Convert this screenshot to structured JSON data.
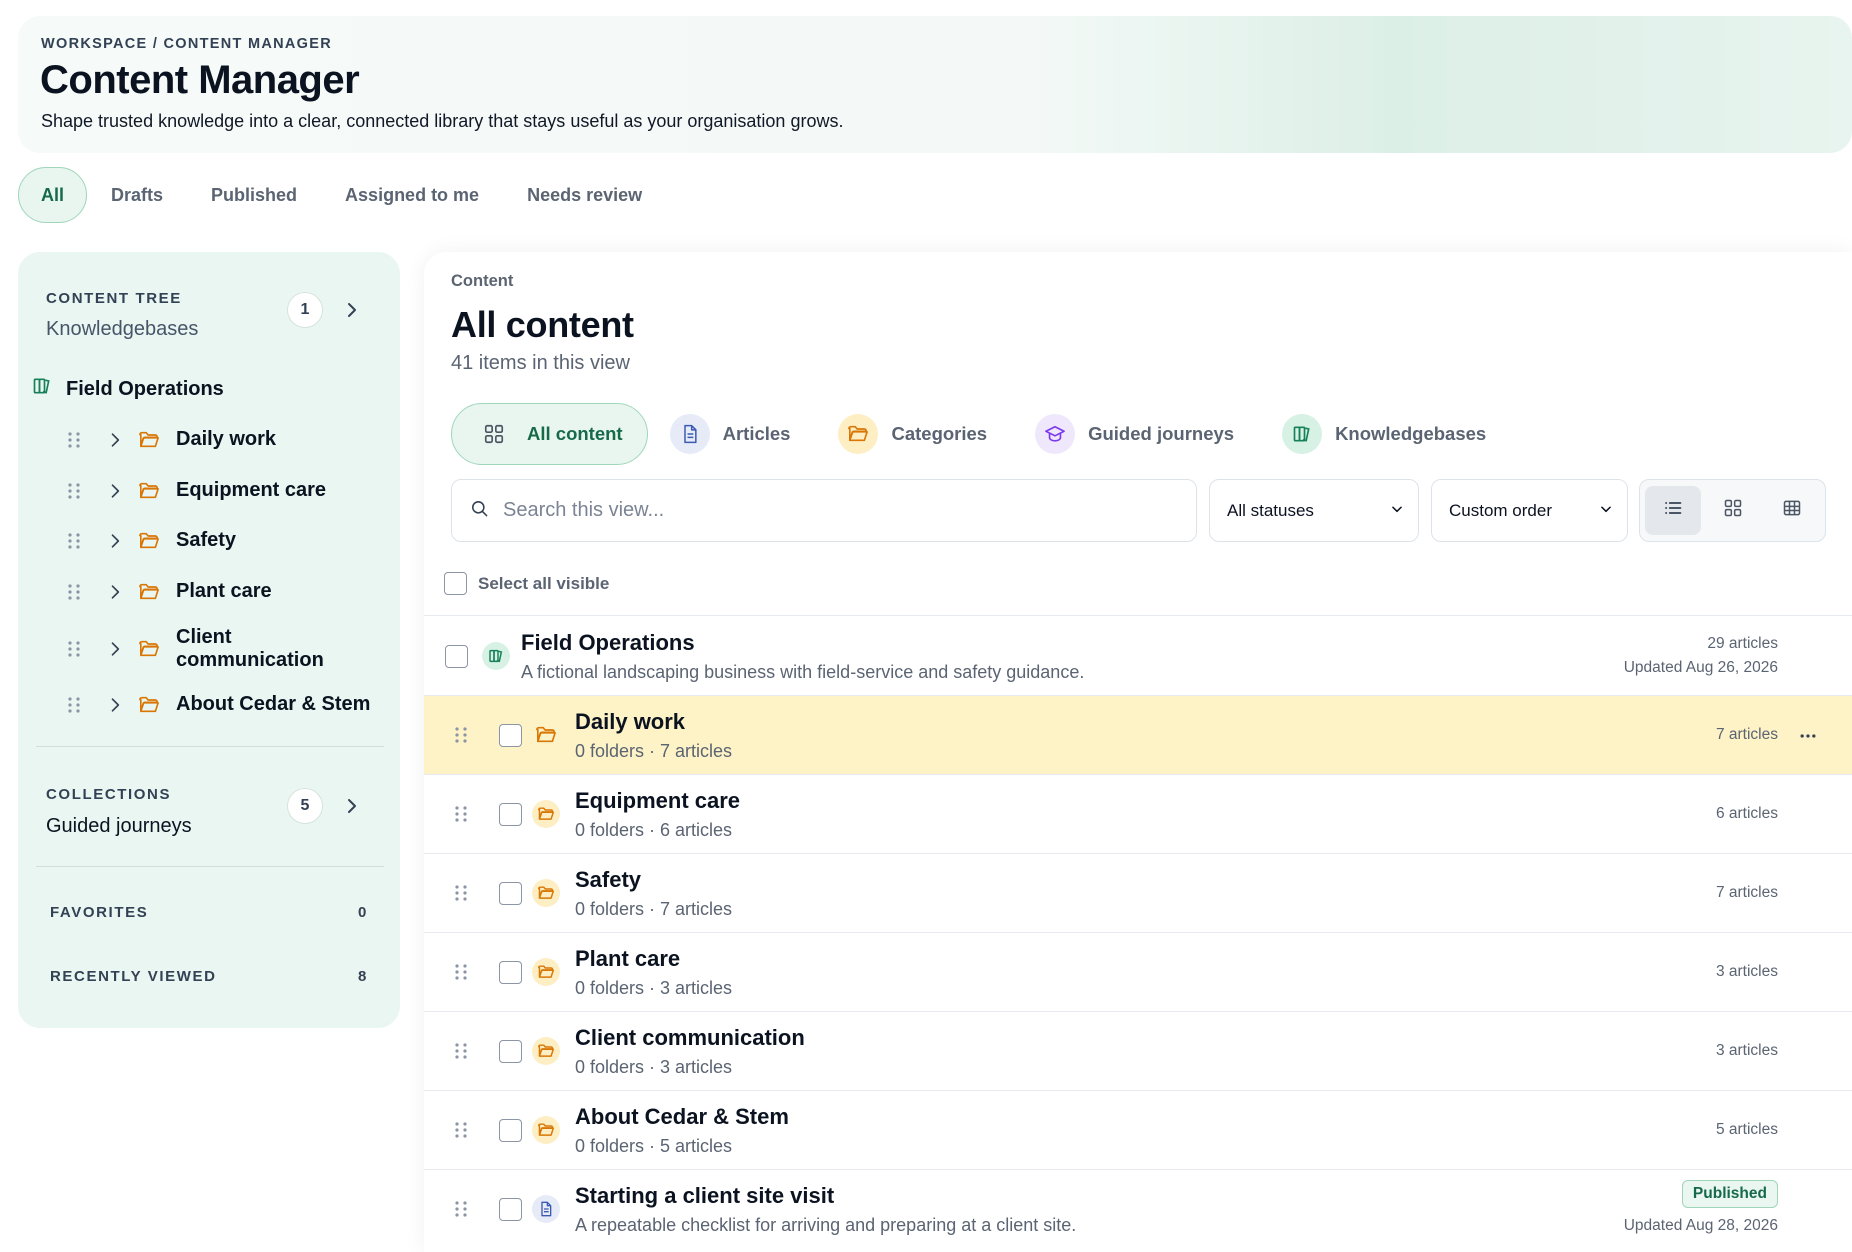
{
  "header": {
    "breadcrumb": "WORKSPACE / CONTENT MANAGER",
    "title": "Content Manager",
    "subtitle": "Shape trusted knowledge into a clear, connected library that stays useful as your organisation grows."
  },
  "top_tabs": [
    {
      "label": "All",
      "active": true
    },
    {
      "label": "Drafts"
    },
    {
      "label": "Published"
    },
    {
      "label": "Assigned to me"
    },
    {
      "label": "Needs review"
    }
  ],
  "sidebar": {
    "content_tree": {
      "label": "CONTENT TREE",
      "sub": "Knowledgebases",
      "count": "1"
    },
    "root": {
      "label": "Field Operations",
      "icon": "knowledgebase-icon"
    },
    "items": [
      {
        "label": "Daily work"
      },
      {
        "label": "Equipment care"
      },
      {
        "label": "Safety"
      },
      {
        "label": "Plant care"
      },
      {
        "label": "Client communication"
      },
      {
        "label": "About Cedar & Stem"
      }
    ],
    "collections": {
      "label": "COLLECTIONS",
      "sub": "Guided journeys",
      "count": "5"
    },
    "favorites": {
      "label": "FAVORITES",
      "count": "0"
    },
    "recently_viewed": {
      "label": "RECENTLY VIEWED",
      "count": "8"
    }
  },
  "main": {
    "label": "Content",
    "title": "All content",
    "count": "41 items in this view",
    "content_tabs": [
      {
        "label": "All content",
        "icon": "grid-icon",
        "active": true
      },
      {
        "label": "Articles",
        "icon": "document-icon"
      },
      {
        "label": "Categories",
        "icon": "folder-icon"
      },
      {
        "label": "Guided journeys",
        "icon": "graduation-cap-icon"
      },
      {
        "label": "Knowledgebases",
        "icon": "knowledgebase-icon"
      }
    ],
    "search": {
      "placeholder": "Search this view..."
    },
    "status_select": "All statuses",
    "order_select": "Custom order",
    "select_all": "Select all visible",
    "rows": [
      {
        "title": "Field Operations",
        "sub": "A fictional landscaping business with field-service and safety guidance.",
        "meta1": "29 articles",
        "meta2": "Updated Aug 26, 2026",
        "type": "knowledgebase"
      },
      {
        "title": "Daily work",
        "sub": "0 folders · 7 articles",
        "meta1": "7 articles",
        "type": "folder",
        "highlighted": true
      },
      {
        "title": "Equipment care",
        "sub": "0 folders · 6 articles",
        "meta1": "6 articles",
        "type": "folder"
      },
      {
        "title": "Safety",
        "sub": "0 folders · 7 articles",
        "meta1": "7 articles",
        "type": "folder"
      },
      {
        "title": "Plant care",
        "sub": "0 folders · 3 articles",
        "meta1": "3 articles",
        "type": "folder"
      },
      {
        "title": "Client communication",
        "sub": "0 folders · 3 articles",
        "meta1": "3 articles",
        "type": "folder"
      },
      {
        "title": "About Cedar & Stem",
        "sub": "0 folders · 5 articles",
        "meta1": "5 articles",
        "type": "folder"
      },
      {
        "title": "Starting a client site visit",
        "sub": "A repeatable checklist for arriving and preparing at a client site.",
        "badge": "Published",
        "meta2": "Updated Aug 28, 2026",
        "type": "article"
      }
    ]
  },
  "colors": {
    "accent": "#166a4a",
    "accent_bg": "#e8f6ef",
    "sidebar_bg": "#eaf6f1",
    "highlight_row": "#fdf3c6",
    "folder": "#d97706"
  }
}
